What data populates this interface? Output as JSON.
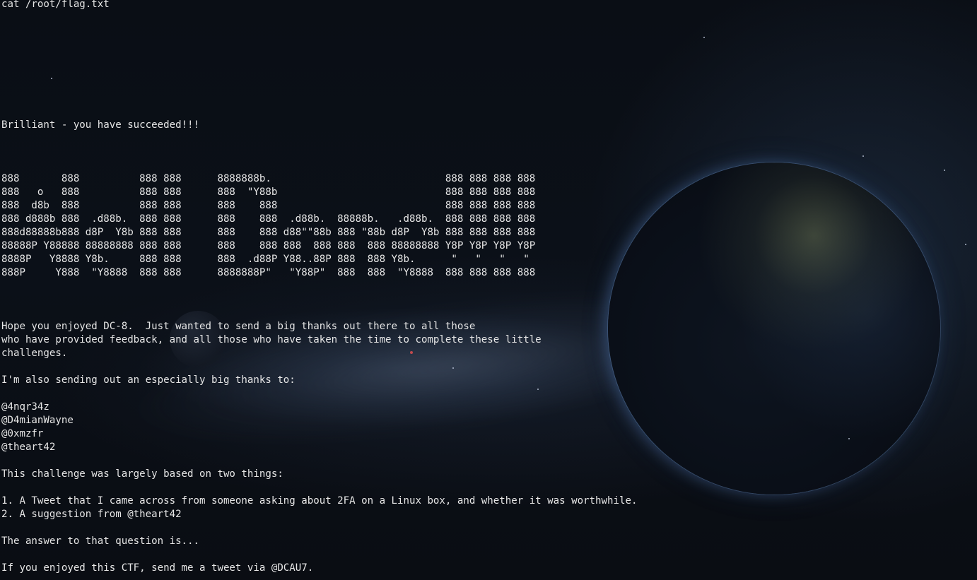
{
  "command": "cat /root/flag.txt",
  "message": "Brilliant - you have succeeded!!!",
  "banner": [
    "888       888          888 888      8888888b.                             888 888 888 888",
    "888   o   888          888 888      888  \"Y88b                            888 888 888 888",
    "888  d8b  888          888 888      888    888                            888 888 888 888",
    "888 d888b 888  .d88b.  888 888      888    888  .d88b.  88888b.   .d88b.  888 888 888 888",
    "888d88888b888 d8P  Y8b 888 888      888    888 d88\"\"88b 888 \"88b d8P  Y8b 888 888 888 888",
    "88888P Y88888 88888888 888 888      888    888 888  888 888  888 88888888 Y8P Y8P Y8P Y8P",
    "8888P   Y8888 Y8b.     888 888      888  .d88P Y88..88P 888  888 Y8b.      \"   \"   \"   \"",
    "888P     Y888  \"Y8888  888 888      8888888P\"   \"Y88P\"  888  888  \"Y8888  888 888 888 888"
  ],
  "body": {
    "thanks_1": "Hope you enjoyed DC-8.  Just wanted to send a big thanks out there to all those",
    "thanks_2": "who have provided feedback, and all those who have taken the time to complete these little",
    "thanks_3": "challenges.",
    "special": "I'm also sending out an especially big thanks to:",
    "handles": [
      "@4nqr34z",
      "@D4mianWayne",
      "@0xmzfr",
      "@theart42"
    ],
    "based_on": "This challenge was largely based on two things:",
    "item_1": "1. A Tweet that I came across from someone asking about 2FA on a Linux box, and whether it was worthwhile.",
    "item_2": "2. A suggestion from @theart42",
    "answer": "The answer to that question is...",
    "closing": "If you enjoyed this CTF, send me a tweet via @DCAU7."
  }
}
